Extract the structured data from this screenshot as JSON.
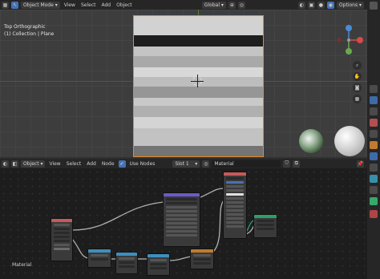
{
  "topbar": {
    "mode": "Object Mode",
    "menus": [
      "View",
      "Select",
      "Add",
      "Object"
    ],
    "orientation": "Global",
    "options": "Options"
  },
  "viewport": {
    "view_name": "Top Orthographic",
    "collection": "(1) Collection | Plane"
  },
  "node_header": {
    "type": "Object",
    "menus": [
      "View",
      "Select",
      "Add",
      "Node"
    ],
    "use_nodes": "Use Nodes",
    "slot": "Slot 1",
    "material": "Material"
  },
  "node_editor": {
    "label": "Material"
  },
  "colors": {
    "selection_outline": "#e68a26",
    "active_blue": "#4772b3",
    "shader_node_header": "#6a5acd",
    "texture_node_header": "#c65a5a",
    "output_node_header": "#c65a5a",
    "converter_node_header": "#3e8fbd",
    "material_output_header": "#2e9e6a"
  },
  "icons": {
    "gizmo": "navigation-gizmo",
    "zoom": "zoom-icon",
    "pan": "hand-icon",
    "camera": "camera-icon",
    "hdri": "hdri-preview-sphere",
    "material_ball": "material-preview-sphere"
  }
}
